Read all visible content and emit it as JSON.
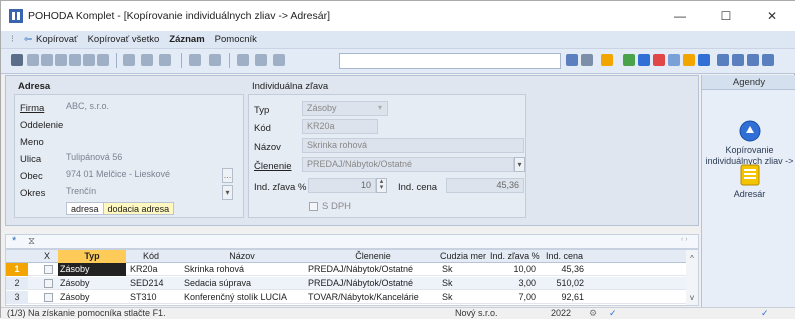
{
  "window": {
    "title": "POHODA Komplet - [Kopírovanie individuálnych zliav -> Adresár]",
    "controls": {
      "minimize": "—",
      "maximize": "☐",
      "close": "✕"
    }
  },
  "menu": {
    "copy": "Kopírovať",
    "copy_all": "Kopírovať všetko",
    "record": "Záznam",
    "help": "Pomocník"
  },
  "address": {
    "section_title": "Adresa",
    "labels": {
      "firm": "Firma",
      "dept": "Oddelenie",
      "name": "Meno",
      "street": "Ulica",
      "city": "Obec",
      "district": "Okres"
    },
    "values": {
      "firm": "ABC, s.r.o.",
      "dept": "",
      "name": "",
      "street": "Tulipánová 56",
      "city": "974 01 Melčice - Lieskové",
      "district": "Trenčín"
    },
    "tabs": [
      "adresa",
      "dodacia adresa"
    ]
  },
  "discount": {
    "section_title": "Individuálna zľava",
    "labels": {
      "type": "Typ",
      "code": "Kód",
      "name": "Názov",
      "category": "Členenie",
      "pct": "Ind. zľava %",
      "price": "Ind. cena",
      "vat": "S DPH"
    },
    "values": {
      "type": "Zásoby",
      "code": "KR20a",
      "name": "Skrinka rohová",
      "category": "PREDAJ/Nábytok/Ostatné",
      "pct": "10",
      "price": "45,36"
    }
  },
  "agendas": {
    "header": "Agendy",
    "items": [
      {
        "label": "Kopírovanie individuálnych zliav ->",
        "icon": "copy-discounts-icon"
      },
      {
        "label": "Adresár",
        "icon": "address-book-icon"
      }
    ]
  },
  "grid": {
    "columns": [
      "X",
      "Typ",
      "Kód",
      "Názov",
      "Členenie",
      "Cudzia mer",
      "Ind. zľava %",
      "Ind. cena"
    ],
    "rows": [
      {
        "num": "1",
        "type": "Zásoby",
        "code": "KR20a",
        "name": "Skrinka rohová",
        "category": "PREDAJ/Nábytok/Ostatné",
        "cur": "Sk",
        "pct": "10,00",
        "price": "45,36"
      },
      {
        "num": "2",
        "type": "Zásoby",
        "code": "SED214",
        "name": "Sedacia súprava",
        "category": "PREDAJ/Nábytok/Ostatné",
        "cur": "Sk",
        "pct": "3,00",
        "price": "510,02"
      },
      {
        "num": "3",
        "type": "Zásoby",
        "code": "ST310",
        "name": "Konferenčný stolík LUCIA",
        "category": "TOVAR/Nábytok/Kancelárie",
        "cur": "Sk",
        "pct": "7,00",
        "price": "92,61"
      }
    ]
  },
  "status": {
    "hint": "(1/3) Na získanie pomocníka stlačte F1.",
    "company": "Nový s.r.o.",
    "year": "2022"
  },
  "colors": {
    "accent": "#2f6fd6",
    "selected_row": "#f2a400",
    "sort_col": "#ffcb58"
  }
}
